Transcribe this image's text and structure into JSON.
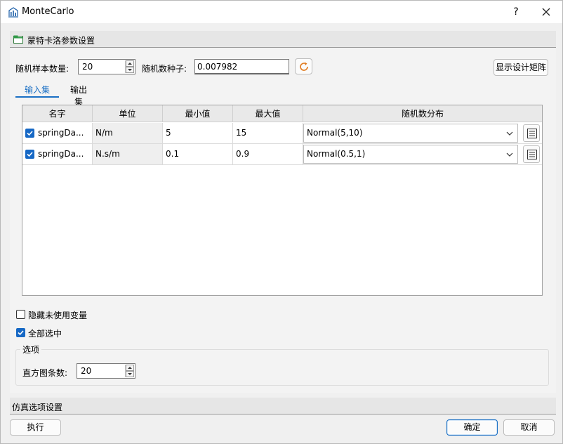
{
  "window": {
    "title": "MonteCarlo",
    "help_label": "?",
    "app_icon": "bar-chart-icon",
    "close_icon": "close-icon"
  },
  "section_params": {
    "title": "蒙特卡洛参数设置",
    "icon": "folder-icon"
  },
  "sample_count": {
    "label": "随机样本数量:",
    "value": "20"
  },
  "seed": {
    "label": "随机数种子:",
    "value": "0.007982",
    "refresh_icon": "refresh-icon"
  },
  "show_matrix_label": "显示设计矩阵",
  "tabs": [
    {
      "label": "输入集",
      "active": true
    },
    {
      "label": "输出集",
      "active": false
    }
  ],
  "table": {
    "headers": [
      "名字",
      "单位",
      "最小值",
      "最大值",
      "随机数分布"
    ],
    "rows": [
      {
        "checked": true,
        "name": "springDa...",
        "unit": "N/m",
        "min": "5",
        "max": "15",
        "distribution": "Normal(5,10)"
      },
      {
        "checked": true,
        "name": "springDa...",
        "unit": "N.s/m",
        "min": "0.1",
        "max": "0.9",
        "distribution": "Normal(0.5,1)"
      }
    ]
  },
  "hide_unused": {
    "label": "隐藏未使用变量",
    "checked": false
  },
  "select_all": {
    "label": "全部选中",
    "checked": true
  },
  "options_group": {
    "legend": "选项",
    "histogram_label": "直方图条数:",
    "histogram_value": "20"
  },
  "section_sim": {
    "title": "仿真选项设置"
  },
  "footer": {
    "run_label": "执行",
    "ok_label": "确定",
    "cancel_label": "取消"
  },
  "colors": {
    "accent": "#1a6fc4",
    "refresh": "#e07a1f"
  }
}
